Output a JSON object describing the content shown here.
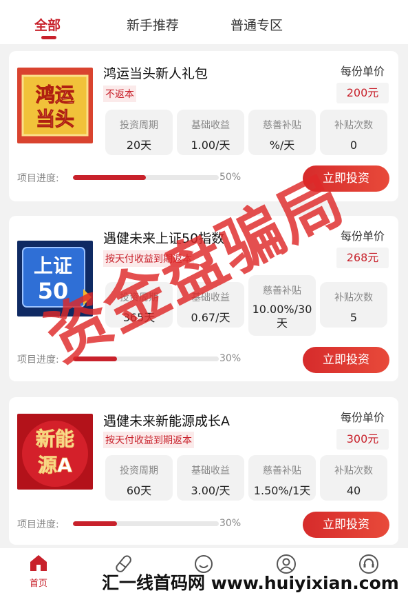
{
  "tabs": [
    {
      "label": "全部",
      "active": true
    },
    {
      "label": "新手推荐",
      "active": false
    },
    {
      "label": "普通专区",
      "active": false
    }
  ],
  "labels": {
    "term": "投资周期",
    "base_yield": "基础收益",
    "charity_subsidy": "慈善补贴",
    "subsidy_count": "补贴次数",
    "progress": "项目进度:",
    "price": "每份单价",
    "invest_button": "立即投资"
  },
  "products": [
    {
      "name": "鸿运当头新人礼包",
      "tag": "不返本",
      "thumb_text": [
        "鸿运",
        "当头"
      ],
      "price": "200元",
      "term": "20天",
      "base_yield": "1.00/天",
      "charity_subsidy": "%/天",
      "subsidy_count": "0",
      "progress_pct": "50%",
      "progress": 0.5
    },
    {
      "name": "遇健未来上证50指数",
      "tag": "按天付收益到期返本",
      "thumb_text": [
        "上证",
        "50"
      ],
      "price": "268元",
      "term": "365天",
      "base_yield": "0.67/天",
      "charity_subsidy": "10.00%/30天",
      "subsidy_count": "5",
      "progress_pct": "30%",
      "progress": 0.3
    },
    {
      "name": "遇健未来新能源成长A",
      "tag": "按天付收益到期返本",
      "thumb_text": [
        "新能",
        "源A"
      ],
      "price": "300元",
      "term": "60天",
      "base_yield": "3.00/天",
      "charity_subsidy": "1.50%/1天",
      "subsidy_count": "40",
      "progress_pct": "30%",
      "progress": 0.3
    }
  ],
  "bottom_nav": [
    {
      "label": "首页",
      "icon": "home-icon",
      "active": true
    },
    {
      "label": "",
      "icon": "pill-icon",
      "active": false
    },
    {
      "label": "",
      "icon": "smile-icon",
      "active": false
    },
    {
      "label": "",
      "icon": "user-icon",
      "active": false
    },
    {
      "label": "",
      "icon": "headset-icon",
      "active": false
    }
  ],
  "watermark": {
    "stamp": "资金盘骗局",
    "footer": "汇一线首码网 www.huiyixian.com"
  },
  "colors": {
    "accent": "#c8212b",
    "background": "#f2f2f2"
  }
}
